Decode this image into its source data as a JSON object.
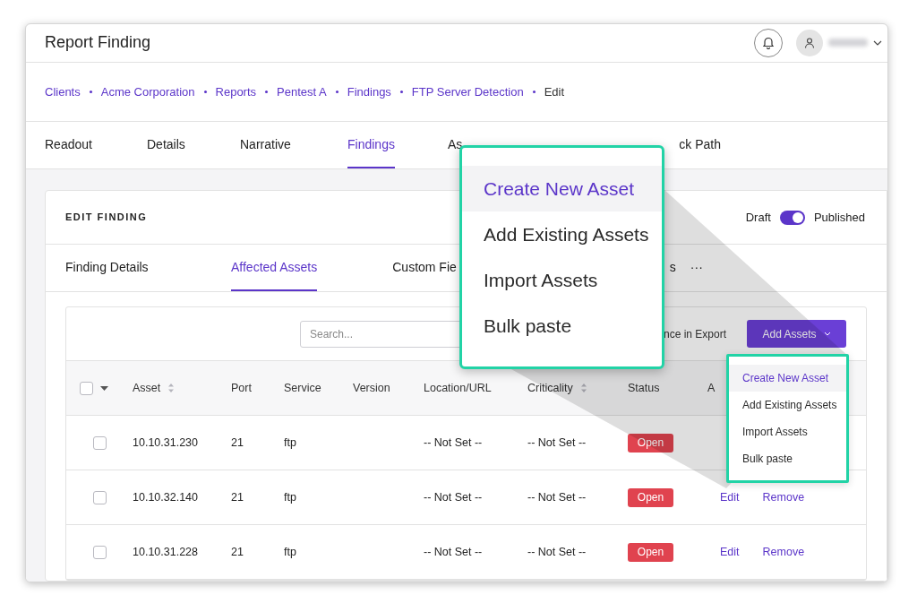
{
  "header": {
    "title": "Report Finding"
  },
  "breadcrumb": [
    {
      "label": "Clients",
      "link": true
    },
    {
      "label": "Acme Corporation",
      "link": true
    },
    {
      "label": "Reports",
      "link": true
    },
    {
      "label": "Pentest A",
      "link": true
    },
    {
      "label": "Findings",
      "link": true
    },
    {
      "label": "FTP Server Detection",
      "link": true
    },
    {
      "label": "Edit",
      "link": false
    }
  ],
  "tabs": [
    {
      "label": "Readout",
      "selected": false
    },
    {
      "label": "Details",
      "selected": false
    },
    {
      "label": "Narrative",
      "selected": false
    },
    {
      "label": "Findings",
      "selected": true
    },
    {
      "label": "As",
      "selected": false
    },
    {
      "label": "ck Path",
      "selected": false
    }
  ],
  "panel": {
    "title": "EDIT FINDING",
    "toggle_left": "Draft",
    "toggle_right": "Published",
    "published": true,
    "tabs": [
      {
        "label": "Finding Details",
        "selected": false
      },
      {
        "label": "Affected Assets",
        "selected": true
      },
      {
        "label": "Custom Fie",
        "selected": false
      },
      {
        "label": "s",
        "selected": false
      },
      {
        "label": "···",
        "selected": false
      }
    ],
    "search": {
      "placeholder": "Search..."
    },
    "export_label": "nce in Export",
    "add_button": "Add Assets",
    "table": {
      "select_all_checked": false,
      "columns": [
        {
          "label": "Asset",
          "sortable": true
        },
        {
          "label": "Port",
          "sortable": false
        },
        {
          "label": "Service",
          "sortable": false
        },
        {
          "label": "Version",
          "sortable": false
        },
        {
          "label": "Location/URL",
          "sortable": false
        },
        {
          "label": "Criticality",
          "sortable": true
        },
        {
          "label": "Status",
          "sortable": false
        },
        {
          "label": "A",
          "sortable": false
        }
      ],
      "rows": [
        {
          "checked": false,
          "asset": "10.10.31.230",
          "port": "21",
          "service": "ftp",
          "location": "-- Not Set --",
          "criticality": "-- Not Set --",
          "status": "Open",
          "actions": []
        },
        {
          "checked": false,
          "asset": "10.10.32.140",
          "port": "21",
          "service": "ftp",
          "location": "-- Not Set --",
          "criticality": "-- Not Set --",
          "status": "Open",
          "actions": [
            "Edit",
            "Remove"
          ]
        },
        {
          "checked": false,
          "asset": "10.10.31.228",
          "port": "21",
          "service": "ftp",
          "location": "-- Not Set --",
          "criticality": "-- Not Set --",
          "status": "Open",
          "actions": [
            "Edit",
            "Remove"
          ]
        }
      ]
    }
  },
  "dropdown": {
    "items": [
      {
        "label": "Create New Asset",
        "selected": true
      },
      {
        "label": "Add Existing Assets",
        "selected": false
      },
      {
        "label": "Import Assets",
        "selected": false
      },
      {
        "label": "Bulk paste",
        "selected": false
      }
    ]
  },
  "callout": {
    "items": [
      {
        "label": "Create New Asset",
        "selected": true
      },
      {
        "label": "Add Existing Assets",
        "selected": false
      },
      {
        "label": "Import Assets",
        "selected": false
      },
      {
        "label": "Bulk paste",
        "selected": false
      }
    ]
  }
}
